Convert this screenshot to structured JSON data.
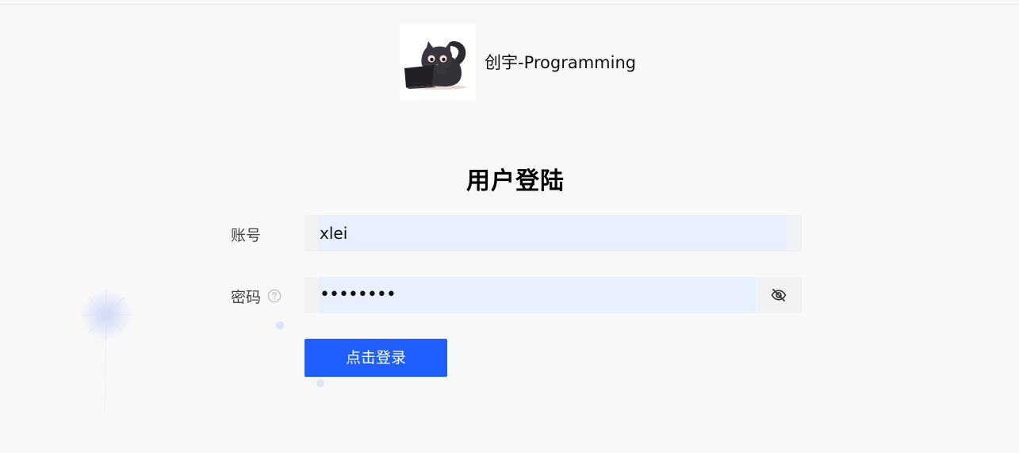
{
  "header": {
    "site_name": "创宇-Programming",
    "logo_icon": "cat-laptop-logo"
  },
  "login": {
    "title": "用户登陆",
    "account_label": "账号",
    "account_value": "xlei",
    "password_label": "密码",
    "password_value": "••••••••",
    "help_icon": "question-circle-icon",
    "toggle_icon": "eye-off-icon",
    "submit_label": "点击登录"
  },
  "colors": {
    "background": "#f8f8f8",
    "input_bg": "#f1f2f4",
    "autofill_bg": "#e8f0fe",
    "primary": "#1f5eff",
    "label_text": "#444444"
  }
}
